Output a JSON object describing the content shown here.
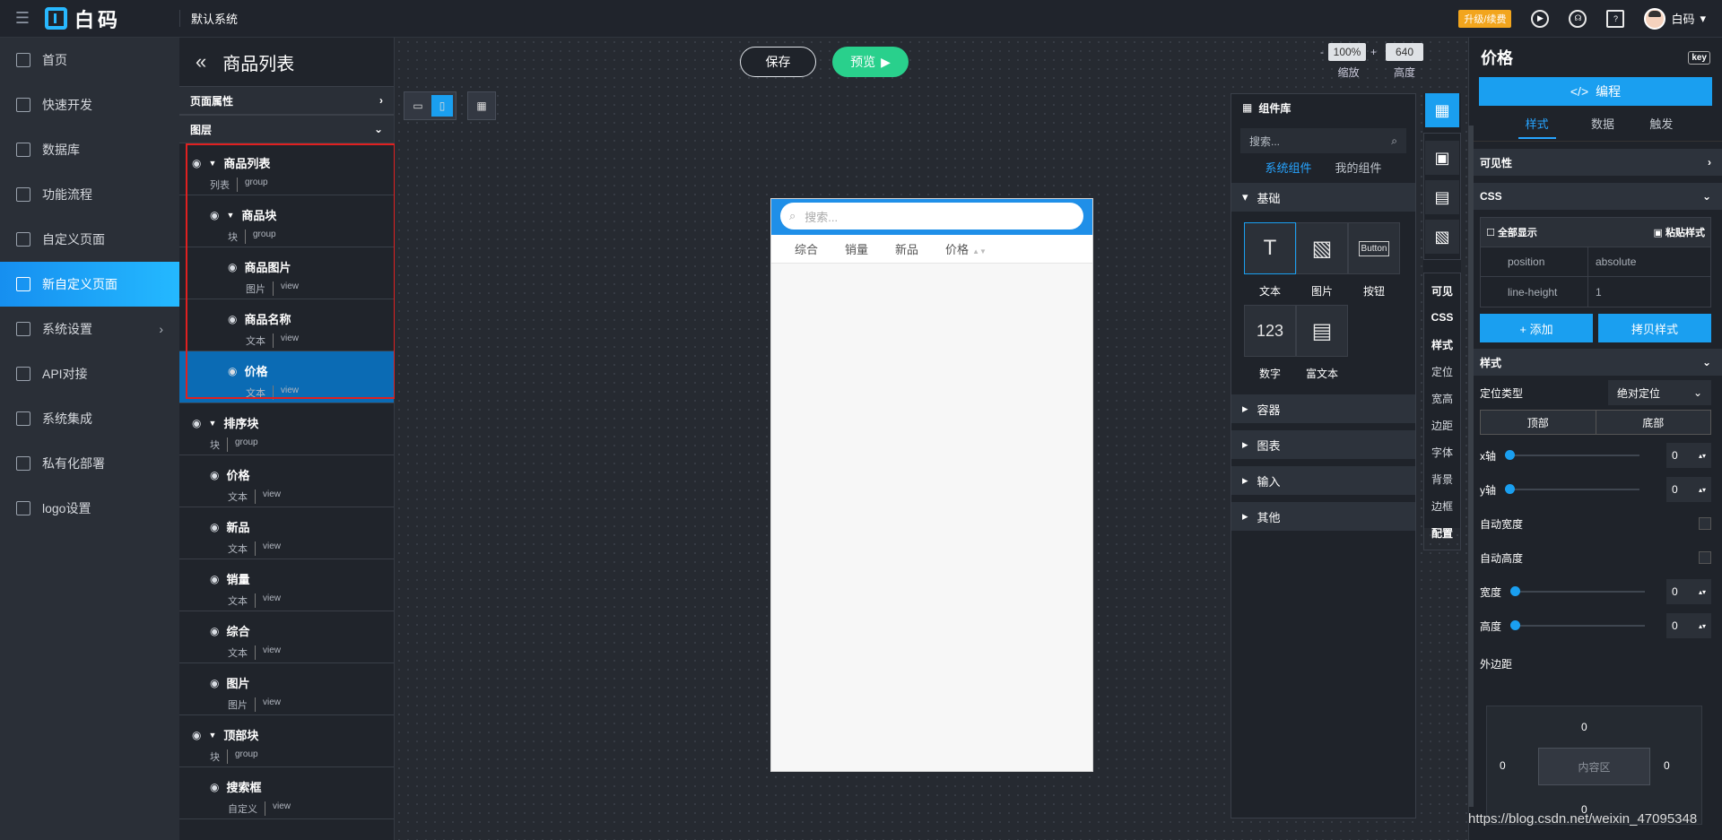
{
  "topbar": {
    "logo": "白码",
    "system": "默认系统",
    "upgrade": "升级/续费",
    "username": "白码"
  },
  "sidebar": {
    "items": [
      {
        "label": "首页"
      },
      {
        "label": "快速开发"
      },
      {
        "label": "数据库"
      },
      {
        "label": "功能流程"
      },
      {
        "label": "自定义页面"
      },
      {
        "label": "新自定义页面",
        "active": true
      },
      {
        "label": "系统设置",
        "has_arrow": true
      },
      {
        "label": "API对接"
      },
      {
        "label": "系统集成"
      },
      {
        "label": "私有化部署"
      },
      {
        "label": "logo设置"
      }
    ]
  },
  "page": {
    "title": "商品列表",
    "save": "保存",
    "preview": "预览"
  },
  "zoom": {
    "minus": "-",
    "value": "100%",
    "plus": "+",
    "label": "缩放",
    "height": "640",
    "height_label": "高度"
  },
  "panels": {
    "page_props": "页面属性",
    "layers": "图层"
  },
  "layers": [
    {
      "name": "商品列表",
      "type": "列表",
      "kind": "group",
      "indent": 0,
      "expanded": true
    },
    {
      "name": "商品块",
      "type": "块",
      "kind": "group",
      "indent": 1,
      "expanded": true
    },
    {
      "name": "商品图片",
      "type": "图片",
      "kind": "view",
      "indent": 2
    },
    {
      "name": "商品名称",
      "type": "文本",
      "kind": "view",
      "indent": 2
    },
    {
      "name": "价格",
      "type": "文本",
      "kind": "view",
      "indent": 2,
      "selected": true
    },
    {
      "name": "排序块",
      "type": "块",
      "kind": "group",
      "indent": 0,
      "expanded": true
    },
    {
      "name": "价格",
      "type": "文本",
      "kind": "view",
      "indent": 1
    },
    {
      "name": "新品",
      "type": "文本",
      "kind": "view",
      "indent": 1
    },
    {
      "name": "销量",
      "type": "文本",
      "kind": "view",
      "indent": 1
    },
    {
      "name": "综合",
      "type": "文本",
      "kind": "view",
      "indent": 1
    },
    {
      "name": "图片",
      "type": "图片",
      "kind": "view",
      "indent": 1
    },
    {
      "name": "顶部块",
      "type": "块",
      "kind": "group",
      "indent": 0,
      "expanded": true
    },
    {
      "name": "搜索框",
      "type": "自定义",
      "kind": "view",
      "indent": 1
    }
  ],
  "phone": {
    "search_placeholder": "搜索...",
    "tabs": [
      "综合",
      "销量",
      "新品",
      "价格"
    ]
  },
  "library": {
    "title": "组件库",
    "search": "搜索...",
    "tab_system": "系统组件",
    "tab_mine": "我的组件",
    "categories": [
      "基础",
      "容器",
      "图表",
      "输入",
      "其他"
    ],
    "components": [
      {
        "label": "文本",
        "glyph": "T"
      },
      {
        "label": "图片",
        "glyph": "▧"
      },
      {
        "label": "按钮",
        "glyph": "Button"
      },
      {
        "label": "数字",
        "glyph": "123"
      },
      {
        "label": "富文本",
        "glyph": "▤"
      }
    ]
  },
  "vtoolbar": {
    "labels": [
      "可见",
      "CSS",
      "样式",
      "定位",
      "宽高",
      "边距",
      "字体",
      "背景",
      "边框",
      "配置"
    ]
  },
  "props": {
    "title": "价格",
    "key": "key",
    "code": "编程",
    "tabs": [
      "样式",
      "数据",
      "触发"
    ],
    "visibility": "可见性",
    "css": "CSS",
    "show_all": "全部显示",
    "paste": "粘贴样式",
    "css_rows": [
      {
        "k": "position",
        "v": "absolute"
      },
      {
        "k": "line-height",
        "v": "1"
      }
    ],
    "add": "+ 添加",
    "copy": "拷贝样式",
    "style": "样式",
    "position_type": "定位类型",
    "position_value": "绝对定位",
    "top": "顶部",
    "bottom": "底部",
    "x": "x轴",
    "y": "y轴",
    "xval": "0",
    "yval": "0",
    "auto_width": "自动宽度",
    "auto_height": "自动高度",
    "width": "宽度",
    "height": "高度",
    "wval": "0",
    "hval": "0",
    "margin": "外边距",
    "content": "内容区",
    "m_top": "0",
    "m_right": "0",
    "m_bottom": "0",
    "m_left": "0"
  },
  "watermark": "https://blog.csdn.net/weixin_47095348"
}
